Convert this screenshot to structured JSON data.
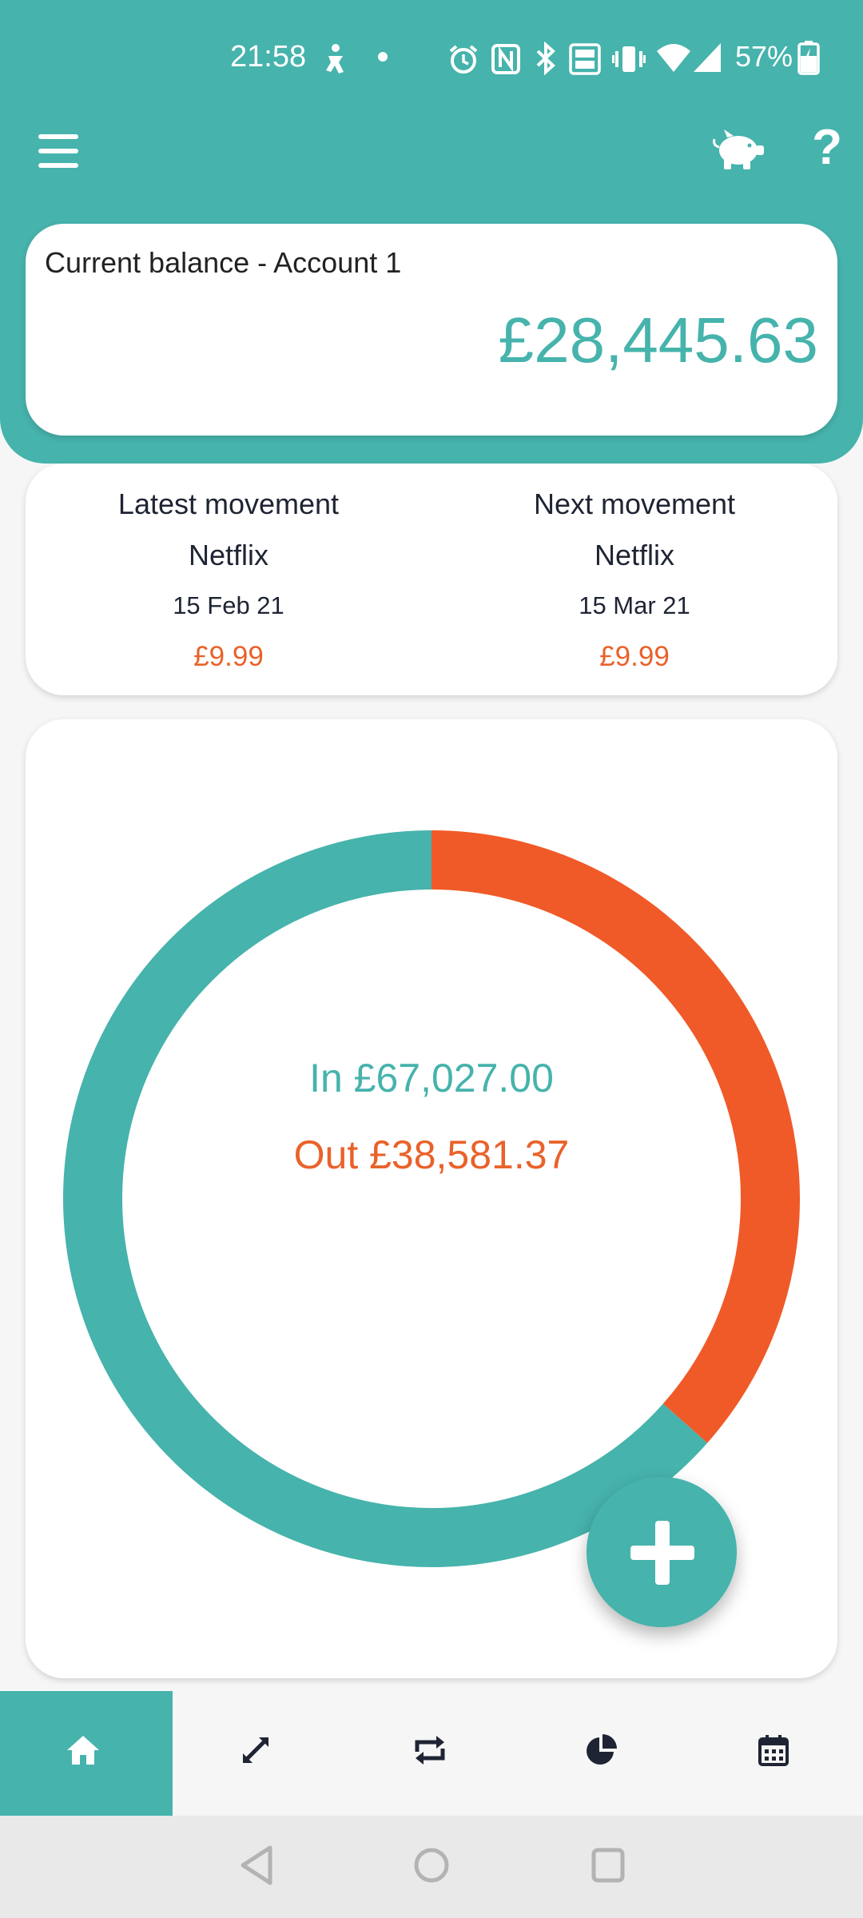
{
  "status_bar": {
    "time": "21:58",
    "battery": "57%",
    "icons": [
      "accessibility-icon",
      "dot-icon",
      "alarm-icon",
      "nfc-icon",
      "bluetooth-icon",
      "volte-icon",
      "vibrate-icon",
      "wifi-icon",
      "signal-icon",
      "battery-charging-icon"
    ]
  },
  "app_bar": {
    "icons": [
      "menu-icon",
      "piggy-bank-icon",
      "help-icon"
    ],
    "help_glyph": "?"
  },
  "balance": {
    "label": "Current balance - Account 1",
    "value": "£28,445.63"
  },
  "movements": {
    "latest": {
      "title": "Latest movement",
      "name": "Netflix",
      "date": "15 Feb 21",
      "amount": "£9.99"
    },
    "next": {
      "title": "Next movement",
      "name": "Netflix",
      "date": "15 Mar 21",
      "amount": "£9.99"
    }
  },
  "summary": {
    "in_text": "In £67,027.00",
    "out_text": "Out £38,581.37",
    "in_value": 67027.0,
    "out_value": 38581.37
  },
  "colors": {
    "primary": "#46b3ac",
    "expense": "#e9622a",
    "expense_ring": "#f05a28"
  },
  "bottom_nav": {
    "items": [
      "home-icon",
      "expand-icon",
      "repeat-icon",
      "pie-chart-icon",
      "calendar-icon"
    ],
    "active": "home-icon"
  },
  "system_nav": {
    "items": [
      "back-icon",
      "home-circle-icon",
      "recents-icon"
    ]
  }
}
